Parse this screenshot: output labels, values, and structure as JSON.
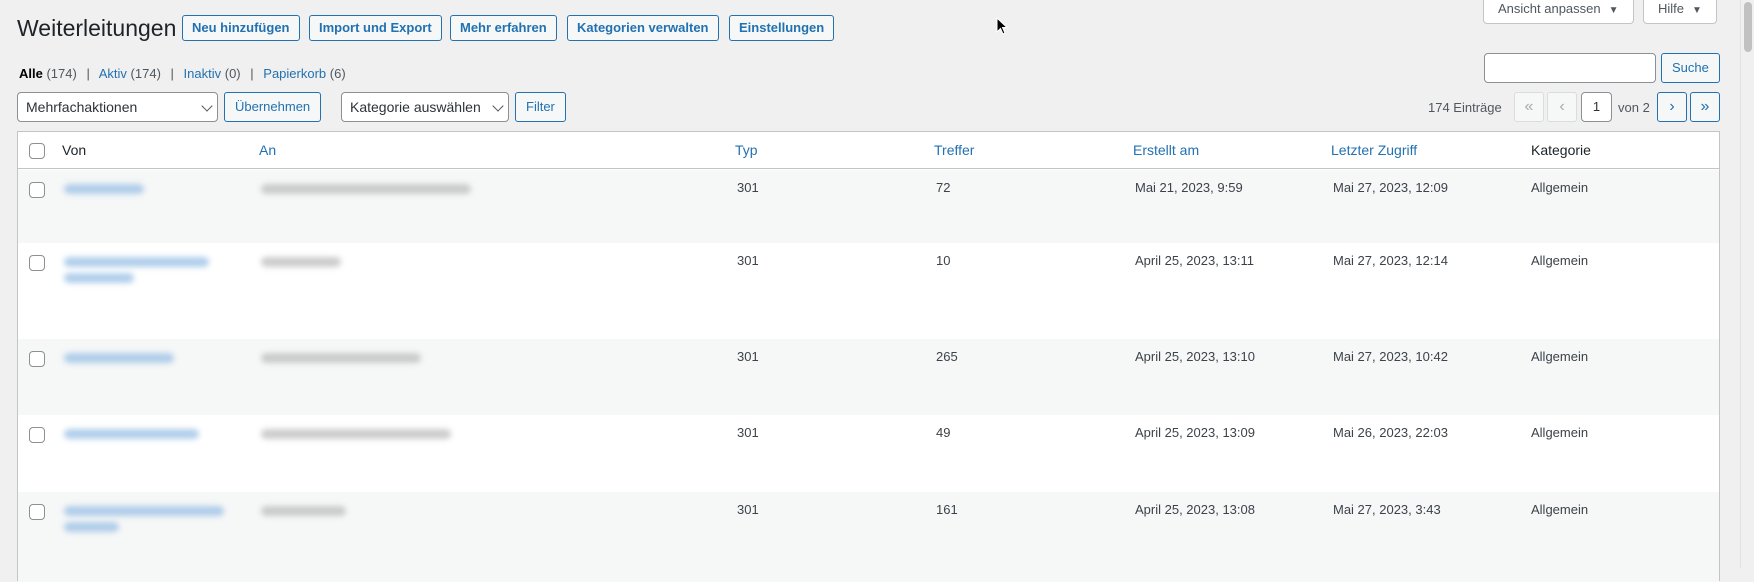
{
  "page": {
    "title": "Weiterleitungen",
    "buttons": {
      "add_new": "Neu hinzufügen",
      "import_export": "Import und Export",
      "learn_more": "Mehr erfahren",
      "manage_categories": "Kategorien verwalten",
      "settings": "Einstellungen"
    },
    "screen_options": "Ansicht anpassen",
    "help": "Hilfe"
  },
  "filters": {
    "all_label": "Alle",
    "all_count": "(174)",
    "active_label": "Aktiv",
    "active_count": "(174)",
    "inactive_label": "Inaktiv",
    "inactive_count": "(0)",
    "trash_label": "Papierkorb",
    "trash_count": "(6)"
  },
  "search": {
    "value": "",
    "button": "Suche"
  },
  "bulk": {
    "select": "Mehrfachaktionen",
    "apply": "Übernehmen",
    "category_select": "Kategorie auswählen",
    "filter": "Filter"
  },
  "pagination": {
    "items": "174 Einträge",
    "first": "«",
    "prev": "‹",
    "current": "1",
    "of": "von 2",
    "next": "›",
    "last": "»"
  },
  "table": {
    "headers": {
      "from": "Von",
      "to": "An",
      "type": "Typ",
      "hits": "Treffer",
      "created": "Erstellt am",
      "last_access": "Letzter Zugriff",
      "category": "Kategorie"
    },
    "rows": [
      {
        "type": "301",
        "hits": "72",
        "created": "Mai 21, 2023, 9:59",
        "last_access": "Mai 27, 2023, 12:09",
        "category": "Allgemein"
      },
      {
        "type": "301",
        "hits": "10",
        "created": "April 25, 2023, 13:11",
        "last_access": "Mai 27, 2023, 12:14",
        "category": "Allgemein"
      },
      {
        "type": "301",
        "hits": "265",
        "created": "April 25, 2023, 13:10",
        "last_access": "Mai 27, 2023, 10:42",
        "category": "Allgemein"
      },
      {
        "type": "301",
        "hits": "49",
        "created": "April 25, 2023, 13:09",
        "last_access": "Mai 26, 2023, 22:03",
        "category": "Allgemein"
      },
      {
        "type": "301",
        "hits": "161",
        "created": "April 25, 2023, 13:08",
        "last_access": "Mai 27, 2023, 3:43",
        "category": "Allgemein"
      }
    ]
  },
  "colors": {
    "link": "#2271b1",
    "text": "#1d2327",
    "background": "#f0f0f1"
  }
}
